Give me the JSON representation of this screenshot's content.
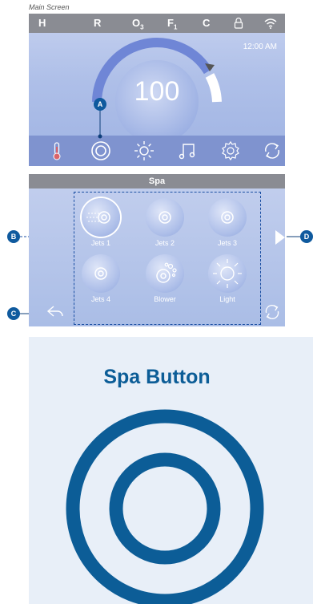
{
  "caption": "Main Screen",
  "main_screen": {
    "status": {
      "h": "H",
      "r": "R",
      "o": "O",
      "o_sub": "3",
      "f": "F",
      "f_sub": "1",
      "c": "C",
      "lock_icon": "lock-icon",
      "wifi_icon": "wifi-icon"
    },
    "clock": "12:00 AM",
    "temperature": "100",
    "dock": [
      "thermometer-icon",
      "spa-icon",
      "light-icon",
      "music-icon",
      "settings-icon",
      "refresh-icon"
    ]
  },
  "spa_screen": {
    "title": "Spa",
    "buttons": [
      {
        "label": "Jets 1"
      },
      {
        "label": "Jets 2"
      },
      {
        "label": "Jets 3"
      },
      {
        "label": "Jets 4"
      },
      {
        "label": "Blower"
      },
      {
        "label": "Light"
      }
    ]
  },
  "callouts": {
    "a": "A",
    "b": "B",
    "c": "C",
    "d": "D"
  },
  "panel": {
    "title": "Spa Button"
  },
  "colors": {
    "accent": "#0c5d97",
    "statusbar": "#8a8c93",
    "dock": "#7f93cf",
    "gauge": "#6f86d6"
  }
}
